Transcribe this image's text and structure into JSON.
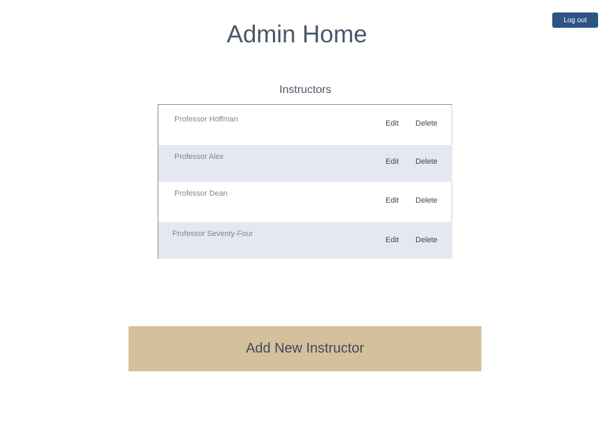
{
  "header": {
    "title": "Admin Home",
    "logout_label": "Log out"
  },
  "instructors": {
    "heading": "Instructors",
    "edit_label": "Edit",
    "delete_label": "Delete",
    "items": [
      {
        "name": "Professor Hoffman"
      },
      {
        "name": "Professor Alex"
      },
      {
        "name": "Professor Dean"
      },
      {
        "name": "Professor Seventy-Four"
      }
    ]
  },
  "actions": {
    "add_label": "Add New Instructor"
  }
}
